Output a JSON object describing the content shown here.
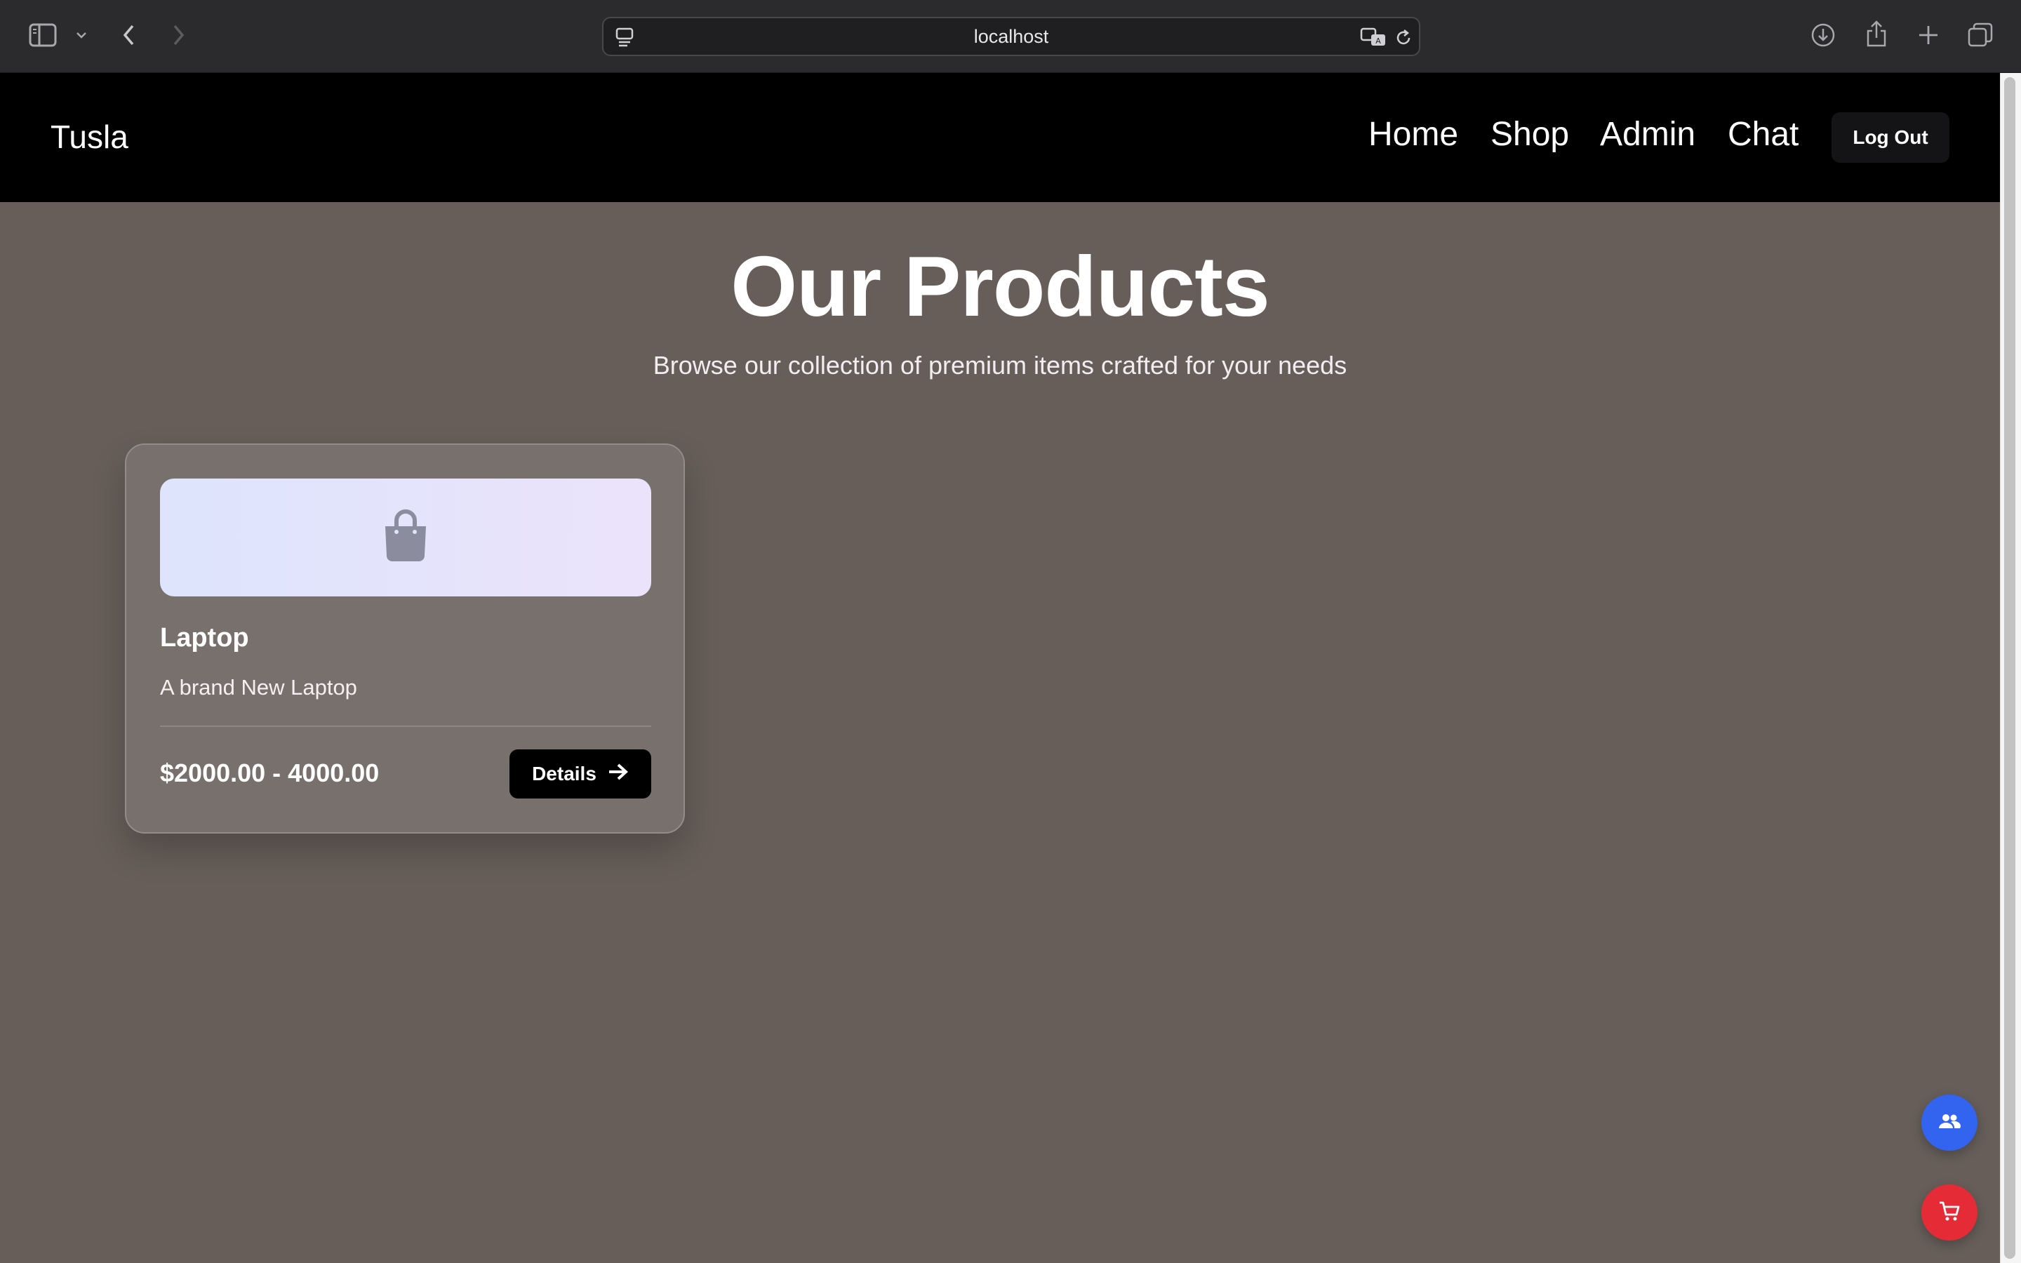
{
  "browser": {
    "url": "localhost"
  },
  "navbar": {
    "brand": "Tusla",
    "links": [
      {
        "label": "Home"
      },
      {
        "label": "Shop"
      },
      {
        "label": "Admin"
      },
      {
        "label": "Chat"
      }
    ],
    "logout_label": "Log Out"
  },
  "main": {
    "title": "Our Products",
    "subtitle": "Browse our collection of premium items crafted for your needs",
    "products": [
      {
        "name": "Laptop",
        "description": "A brand New Laptop",
        "price": "$2000.00 - 4000.00",
        "details_label": "Details",
        "image_icon": "shopping-bag-icon"
      }
    ]
  },
  "fabs": {
    "users_icon": "users-icon",
    "cart_icon": "cart-icon",
    "users_color": "#3264f0",
    "cart_color": "#e52b35"
  },
  "colors": {
    "page_background": "#675e59",
    "navbar_background": "#000000",
    "card_background": "#77706c"
  }
}
